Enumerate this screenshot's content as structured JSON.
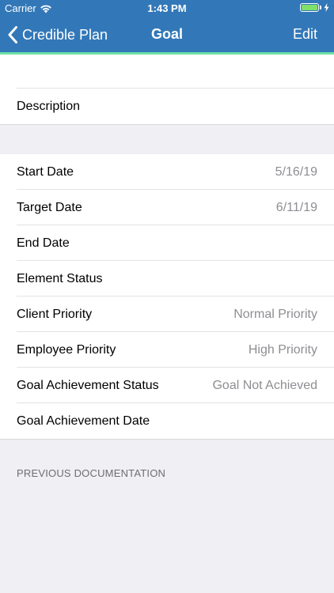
{
  "status_bar": {
    "carrier": "Carrier",
    "time": "1:43 PM",
    "battery_level": 1.0
  },
  "nav": {
    "back_label": "Credible Plan",
    "title": "Goal",
    "edit_label": "Edit"
  },
  "colors": {
    "nav_background": "#3278b8",
    "accent_line": "#6ee0a6",
    "value_text": "#8e8e93"
  },
  "section1": {
    "description_label": "Description"
  },
  "details": [
    {
      "label": "Start Date",
      "value": "5/16/19"
    },
    {
      "label": "Target Date",
      "value": "6/11/19"
    },
    {
      "label": "End Date",
      "value": ""
    },
    {
      "label": "Element Status",
      "value": ""
    },
    {
      "label": "Client Priority",
      "value": "Normal Priority"
    },
    {
      "label": "Employee Priority",
      "value": "High Priority"
    },
    {
      "label": "Goal Achievement Status",
      "value": "Goal Not Achieved"
    },
    {
      "label": "Goal Achievement Date",
      "value": ""
    }
  ],
  "footer": {
    "section_header": "PREVIOUS DOCUMENTATION"
  }
}
